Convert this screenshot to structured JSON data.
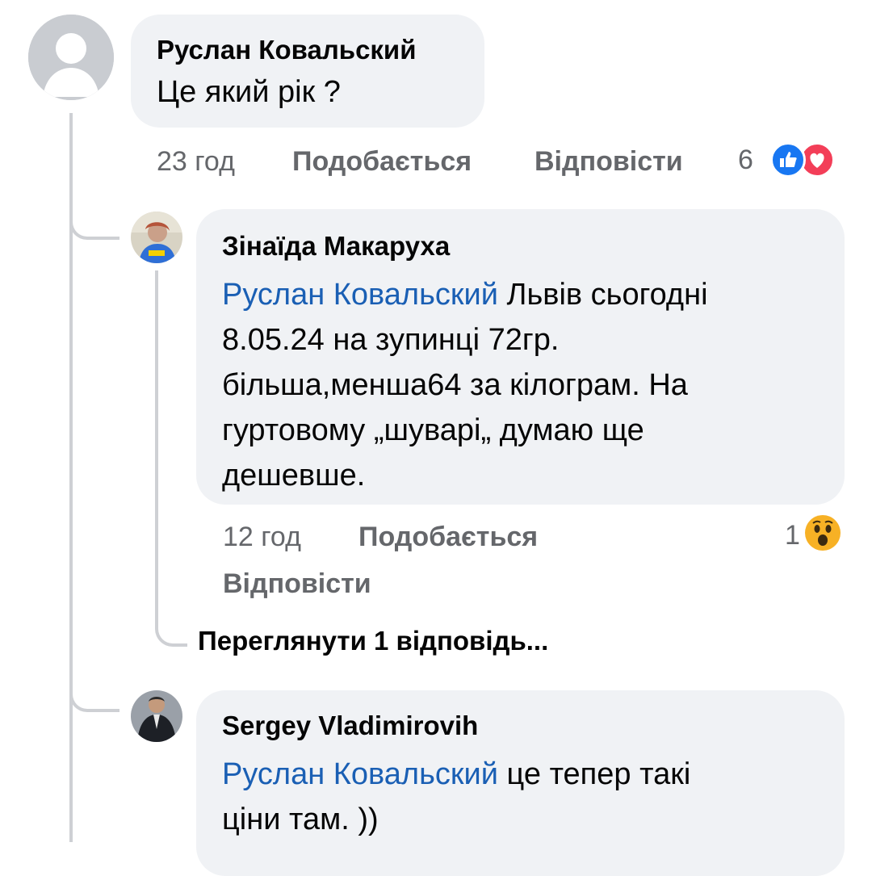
{
  "comment1": {
    "author": "Руслан Ковальский",
    "text": "Це який рік ?",
    "time": "23 год",
    "like_label": "Подобається",
    "reply_label": "Відповісти",
    "reaction_count": "6",
    "reactions": [
      "like-icon",
      "love-icon"
    ]
  },
  "reply1": {
    "author": "Зінаїда Макаруха",
    "mention": "Руслан Ковальский",
    "text_lines": [
      " Львів сьогодні",
      "8.05.24 на зупинці 72гр.",
      "більша,менша64 за кілограм. На",
      "гуртовому „шуварі„ думаю ще",
      "дешевше."
    ],
    "time": "12 год",
    "like_label": "Подобається",
    "reply_label": "Відповісти",
    "reaction_count": "1",
    "reactions": [
      "wow-icon"
    ]
  },
  "view_replies": "Переглянути 1 відповідь...",
  "reply2": {
    "author": "Sergey Vladimirovih",
    "mention": "Руслан Ковальский",
    "text_line1": " це тепер такі",
    "text_line2": "ціни там. ))"
  },
  "colors": {
    "bubble": "#f0f2f5",
    "mention": "#1a5fb4",
    "meta": "#65676b",
    "like": "#1877f2",
    "love": "#f33e58",
    "wow": "#f7b125"
  }
}
